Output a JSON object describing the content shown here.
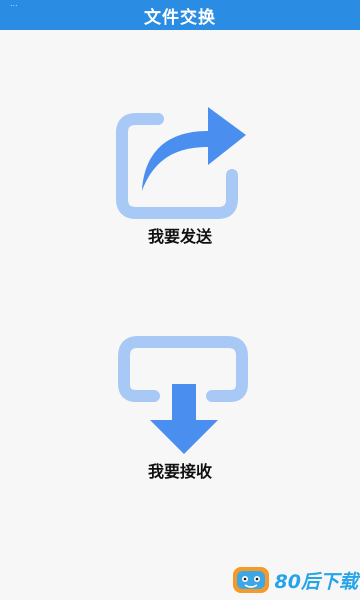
{
  "header": {
    "status_text": "...",
    "title": "文件交换"
  },
  "actions": {
    "send_label": "我要发送",
    "receive_label": "我要接收"
  },
  "watermark": {
    "text": "80后下载",
    "icon": "mascot-logo-icon"
  },
  "colors": {
    "header_bg": "#2a8de3",
    "icon_blue": "#4a8ef0",
    "icon_light_blue": "#a8c8f5",
    "watermark": "#27a4e8"
  }
}
